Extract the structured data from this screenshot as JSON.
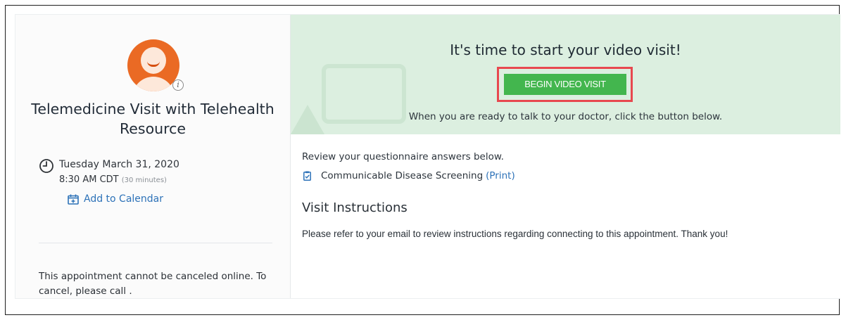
{
  "visit": {
    "title": "Telemedicine Visit with Telehealth Resource",
    "date": "Tuesday March 31, 2020",
    "time": "8:30 AM CDT",
    "duration": "(30 minutes)",
    "add_to_calendar": "Add to Calendar",
    "cancel_note": "This appointment cannot be canceled online. To cancel, please call ."
  },
  "banner": {
    "heading": "It's time to start your video visit!",
    "button_label": "BEGIN VIDEO VISIT",
    "subtext": "When you are ready to talk to your doctor, click the button below."
  },
  "questionnaire": {
    "intro": "Review your questionnaire answers below.",
    "item_label": "Communicable Disease Screening",
    "print_label": "(Print)"
  },
  "instructions": {
    "heading": "Visit Instructions",
    "body": "Please refer to your email to review instructions regarding connecting to this appointment. Thank you!"
  },
  "colors": {
    "accent_orange": "#ea6a24",
    "button_green": "#43b64e",
    "highlight_red": "#e8484f",
    "link_blue": "#2d72b8",
    "banner_green": "#dcefe0"
  }
}
